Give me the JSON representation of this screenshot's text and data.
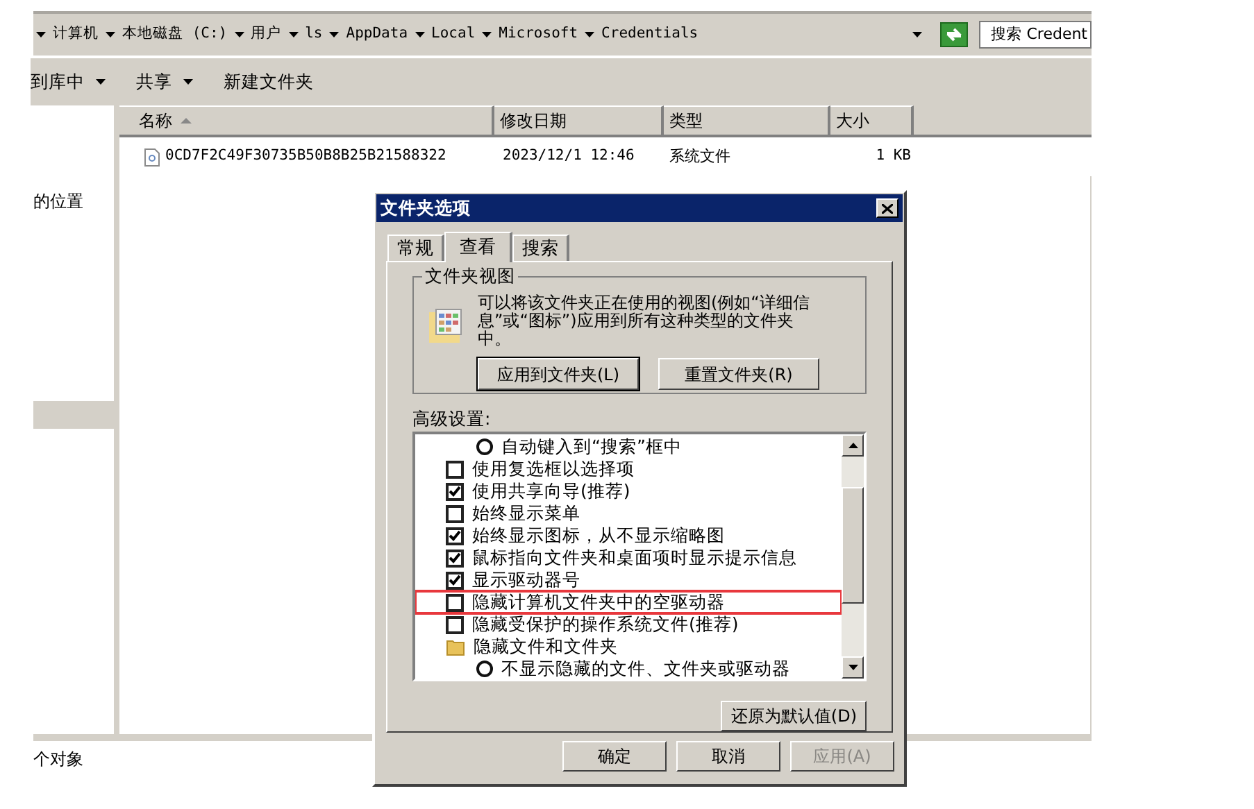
{
  "address_bar": {
    "segments": [
      "计算机",
      "本地磁盘 (C:)",
      "用户",
      "ls",
      "AppData",
      "Local",
      "Microsoft",
      "Credentials"
    ],
    "search_placeholder": "搜索 Credent"
  },
  "toolbar": [
    {
      "label": "到库中",
      "dropdown": true
    },
    {
      "label": "共享",
      "dropdown": true
    },
    {
      "label": "新建文件夹",
      "dropdown": false
    }
  ],
  "nav_pane": {
    "items": [
      "的位置"
    ]
  },
  "table": {
    "columns": [
      {
        "label": "名称",
        "sorted": true
      },
      {
        "label": "修改日期",
        "sorted": false
      },
      {
        "label": "类型",
        "sorted": false
      },
      {
        "label": "大小",
        "sorted": false
      }
    ],
    "rows": [
      {
        "name": "0CD7F2C49F30735B50B8B25B21588322",
        "modified": "2023/12/1 12:46",
        "type": "系统文件",
        "size": "1 KB"
      }
    ]
  },
  "status_bar": "个对象",
  "dialog": {
    "title": "文件夹选项",
    "tabs": [
      {
        "label": "常规",
        "selected": false
      },
      {
        "label": "查看",
        "selected": true
      },
      {
        "label": "搜索",
        "selected": false
      }
    ],
    "folder_views": {
      "title": "文件夹视图",
      "description": "可以将该文件夹正在使用的视图(例如“详细信息”或“图标”)应用到所有这种类型的文件夹中。",
      "buttons": [
        {
          "label": "应用到文件夹(L)",
          "default": true
        },
        {
          "label": "重置文件夹(R)",
          "default": false
        }
      ]
    },
    "advanced_label": "高级设置:",
    "advanced": [
      {
        "kind": "radio",
        "label": "自动键入到“搜索”框中",
        "selected": false,
        "highlighted": false
      },
      {
        "kind": "checkbox",
        "label": "使用复选框以选择项",
        "checked": false,
        "highlighted": false
      },
      {
        "kind": "checkbox",
        "label": "使用共享向导(推荐)",
        "checked": true,
        "highlighted": false
      },
      {
        "kind": "checkbox",
        "label": "始终显示菜单",
        "checked": false,
        "highlighted": false
      },
      {
        "kind": "checkbox",
        "label": "始终显示图标，从不显示缩略图",
        "checked": true,
        "highlighted": false
      },
      {
        "kind": "checkbox",
        "label": "鼠标指向文件夹和桌面项时显示提示信息",
        "checked": true,
        "highlighted": false
      },
      {
        "kind": "checkbox",
        "label": "显示驱动器号",
        "checked": true,
        "highlighted": false
      },
      {
        "kind": "checkbox",
        "label": "隐藏计算机文件夹中的空驱动器",
        "checked": false,
        "highlighted": true
      },
      {
        "kind": "checkbox",
        "label": "隐藏受保护的操作系统文件(推荐)",
        "checked": false,
        "highlighted": false
      },
      {
        "kind": "folder",
        "label": "隐藏文件和文件夹",
        "highlighted": false,
        "children": [
          {
            "kind": "radio",
            "label": "不显示隐藏的文件、文件夹或驱动器",
            "selected": false,
            "highlighted": false
          }
        ]
      }
    ],
    "restore_button": "还原为默认值(D)",
    "buttons": [
      {
        "label": "确定",
        "disabled": false
      },
      {
        "label": "取消",
        "disabled": false
      },
      {
        "label": "应用(A)",
        "disabled": true
      }
    ]
  }
}
